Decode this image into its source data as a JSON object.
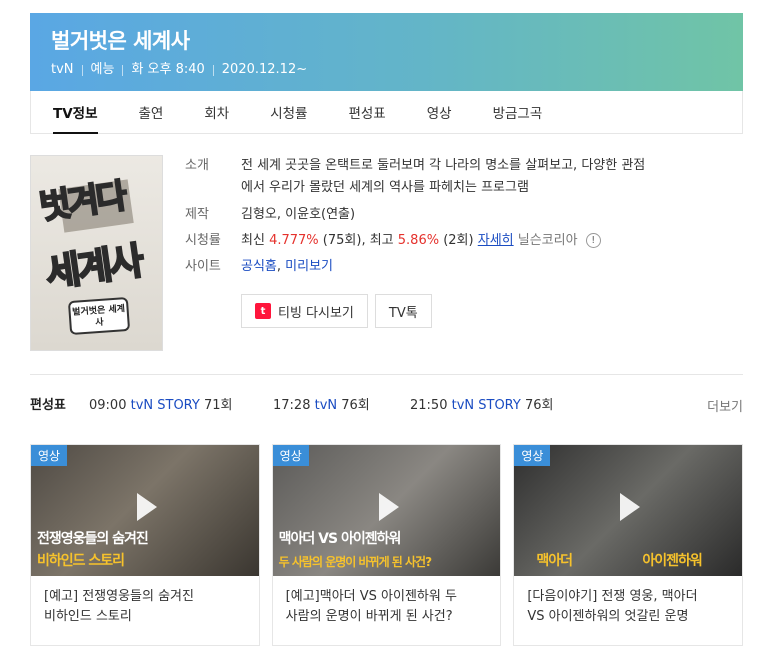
{
  "header": {
    "title": "벌거벗은 세계사",
    "channel": "tvN",
    "genre": "예능",
    "airtime": "화 오후 8:40",
    "start_date": "2020.12.12~"
  },
  "tabs": [
    {
      "label": "TV정보",
      "active": true
    },
    {
      "label": "출연",
      "active": false
    },
    {
      "label": "회차",
      "active": false
    },
    {
      "label": "시청률",
      "active": false
    },
    {
      "label": "편성표",
      "active": false
    },
    {
      "label": "영상",
      "active": false
    },
    {
      "label": "방금그곡",
      "active": false
    }
  ],
  "poster": {
    "title_top": "벗겨다",
    "title_bottom": "세계사",
    "badge": "벌거벗은 세계사"
  },
  "info": {
    "intro_label": "소개",
    "intro_line1": "전 세계 곳곳을 온택트로 둘러보며 각 나라의 명소를 살펴보고, 다양한 관점",
    "intro_line2": "에서 우리가 몰랐던 세계의 역사를 파헤치는 프로그램",
    "production_label": "제작",
    "production_value": "김형오, 이윤호(연출)",
    "ratings_label": "시청률",
    "ratings_latest_prefix": "최신",
    "ratings_latest_value": "4.777%",
    "ratings_latest_ep": "(75회)",
    "ratings_best_prefix": ", 최고",
    "ratings_best_value": "5.86%",
    "ratings_best_ep": "(2회)",
    "ratings_detail": "자세히",
    "ratings_source": "닐슨코리아",
    "site_label": "사이트",
    "site_official": "공식홈",
    "site_preview": "미리보기"
  },
  "buttons": {
    "tving_logo": "t",
    "tving": "티빙 다시보기",
    "talk": "TV톡"
  },
  "schedule": {
    "head": "편성표",
    "items": [
      {
        "time": "09:00",
        "channel": "tvN STORY",
        "ep": "71회"
      },
      {
        "time": "17:28",
        "channel": "tvN",
        "ep": "76회"
      },
      {
        "time": "21:50",
        "channel": "tvN STORY",
        "ep": "76회"
      }
    ],
    "more": "더보기"
  },
  "videos": [
    {
      "tag": "영상",
      "cap1": "전쟁영웅들의 숨겨진",
      "cap2": "비하인드 스토리",
      "line1": "[예고] 전쟁영웅들의 숨겨진",
      "line2": "비하인드 스토리"
    },
    {
      "tag": "영상",
      "cap1": "맥아더 VS 아이젠하워",
      "cap2": "두 사람의 운명이 바뀌게 된 사건?",
      "line1": "[예고]맥아더 VS 아이젠하워 두",
      "line2": "사람의 운명이 바뀌게 된 사건?"
    },
    {
      "tag": "영상",
      "cap1": "맥아더",
      "cap2": "아이젠하워",
      "line1": "[다음이야기] 전쟁 영웅, 맥아더",
      "line2": "VS 아이젠하워의 엇갈린 운명"
    }
  ]
}
